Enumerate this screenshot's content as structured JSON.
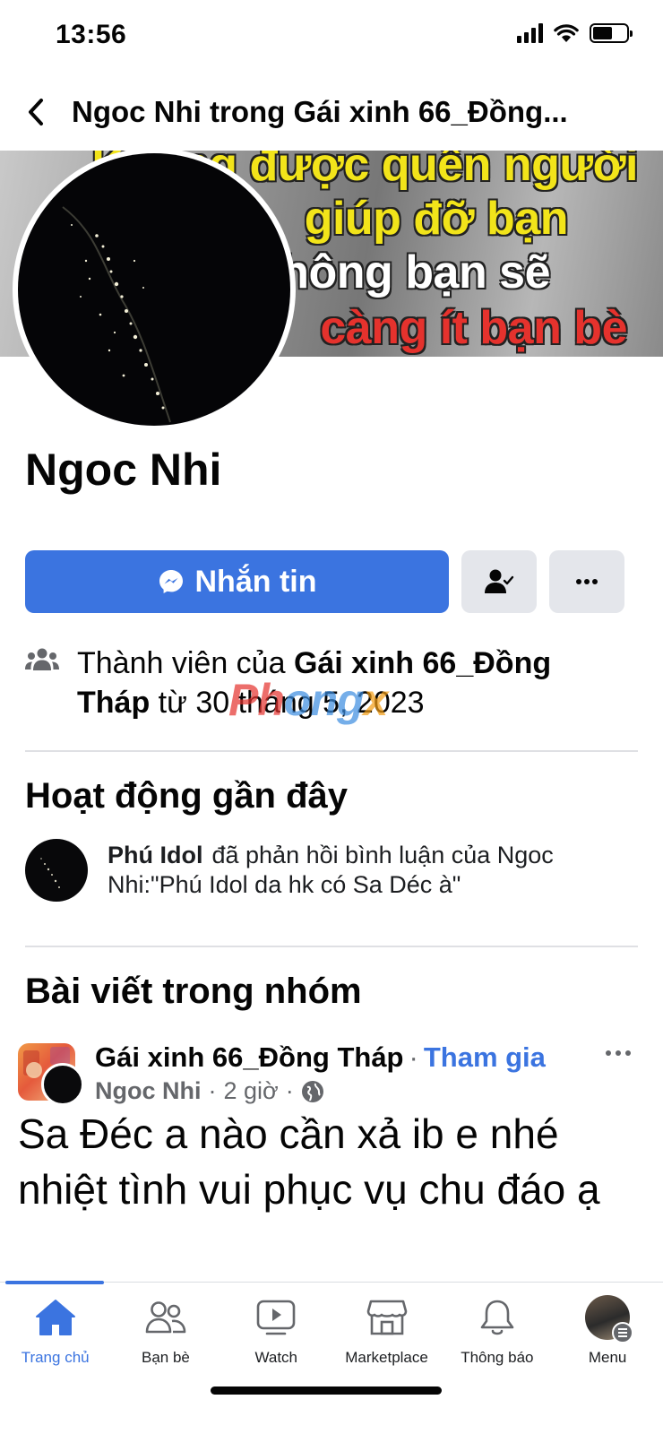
{
  "status_bar": {
    "time": "13:56"
  },
  "header": {
    "title": "Ngoc Nhi trong Gái xinh 66_Đồng..."
  },
  "cover": {
    "lines": [
      "Không được quên người",
      "giúp đỡ bạn",
      "không bạn sẽ",
      "càng ít bạn bè"
    ]
  },
  "profile": {
    "name": "Ngoc Nhi"
  },
  "actions": {
    "message_label": "Nhắn tin"
  },
  "membership": {
    "prefix": "Thành viên của ",
    "group": "Gái xinh 66_Đồng Tháp",
    "suffix": " từ 30 tháng 5, 2023"
  },
  "recent_activity": {
    "title": "Hoạt động gần đây",
    "item": {
      "actor": "Phú Idol",
      "text": "đã phản hồi bình luận của Ngoc Nhi:\"Phú Idol da hk có Sa Déc à\""
    }
  },
  "group_posts": {
    "title": "Bài viết trong nhóm",
    "post": {
      "group": "Gái xinh 66_Đồng Tháp",
      "join_label": "Tham gia",
      "author": "Ngoc Nhi",
      "time": "2 giờ",
      "body": "Sa Đéc  a nào cần xả ib e nhé nhiệt tình  vui phục vụ  chu đáo ạ"
    }
  },
  "watermark": {
    "a": "Ph",
    "b": "ong",
    "c": "x"
  },
  "bottom_nav": {
    "items": [
      {
        "label": "Trang chủ",
        "icon": "home-icon",
        "active": true
      },
      {
        "label": "Bạn bè",
        "icon": "friends-icon",
        "active": false
      },
      {
        "label": "Watch",
        "icon": "watch-icon",
        "active": false
      },
      {
        "label": "Marketplace",
        "icon": "marketplace-icon",
        "active": false
      },
      {
        "label": "Thông báo",
        "icon": "bell-icon",
        "active": false
      },
      {
        "label": "Menu",
        "icon": "menu-avatar",
        "active": false
      }
    ]
  },
  "colors": {
    "accent": "#3b74e0",
    "cover_yellow": "#f2e41a",
    "cover_red": "#e5322d"
  }
}
